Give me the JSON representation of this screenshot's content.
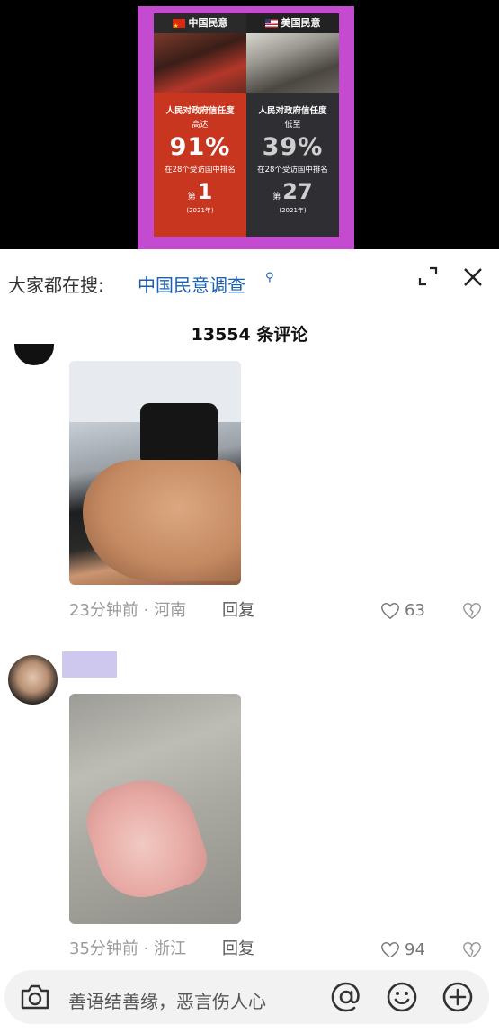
{
  "video": {
    "poster": {
      "left": {
        "header": "中国民意",
        "line1": "人民对政府信任度",
        "line2": "高达",
        "big": "91%",
        "small": "在28个受访国中排名",
        "rank_prefix": "第",
        "rank": "1",
        "year": "(2021年)"
      },
      "right": {
        "header": "美国民意",
        "line1": "人民对政府信任度",
        "line2": "低至",
        "big": "39%",
        "small": "在28个受访国中排名",
        "rank_prefix": "第",
        "rank": "27",
        "year": "(2021年)"
      }
    }
  },
  "search": {
    "prefix": "大家都在搜:",
    "term": "中国民意调查"
  },
  "comments_header": {
    "count_text": "13554 条评论"
  },
  "comments": [
    {
      "meta": "23分钟前 · 河南",
      "reply_label": "回复",
      "likes": "63"
    },
    {
      "meta": "35分钟前 · 浙江",
      "reply_label": "回复",
      "likes": "94"
    }
  ],
  "input_bar": {
    "placeholder": "善语结善缘，恶言伤人心"
  },
  "colors": {
    "accent_link": "#1a5fb4",
    "poster_bg": "#c44bcf",
    "name_redaction": "#cfc8ee"
  }
}
